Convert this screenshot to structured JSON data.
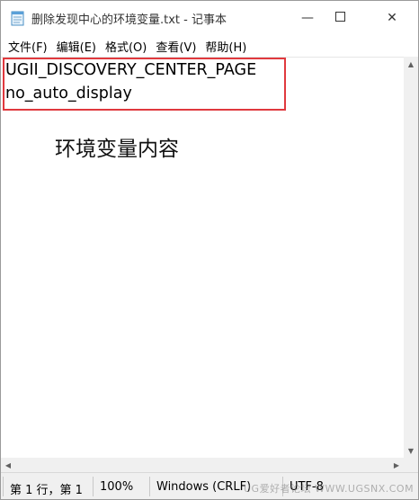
{
  "window": {
    "title": "删除发现中心的环境变量.txt - 记事本",
    "minimize_glyph": "—",
    "maximize_glyph": "☐",
    "close_glyph": "✕"
  },
  "menu": {
    "items": [
      "文件(F)",
      "编辑(E)",
      "格式(O)",
      "查看(V)",
      "帮助(H)"
    ]
  },
  "editor": {
    "lines": [
      "UGII_DISCOVERY_CENTER_PAGE",
      "no_auto_display"
    ],
    "annotation": "环境变量内容",
    "highlight_color": "#e0393e"
  },
  "statusbar": {
    "position": "第 1 行，第 1",
    "zoom": "100%",
    "line_ending": "Windows (CRLF)",
    "encoding": "UTF-8"
  },
  "watermark": "UG爱好者论坛 WWW.UGSNX.COM",
  "icons": {
    "app": "notepad-icon",
    "scroll_up": "▲",
    "scroll_down": "▼",
    "scroll_left": "◀",
    "scroll_right": "▶"
  }
}
